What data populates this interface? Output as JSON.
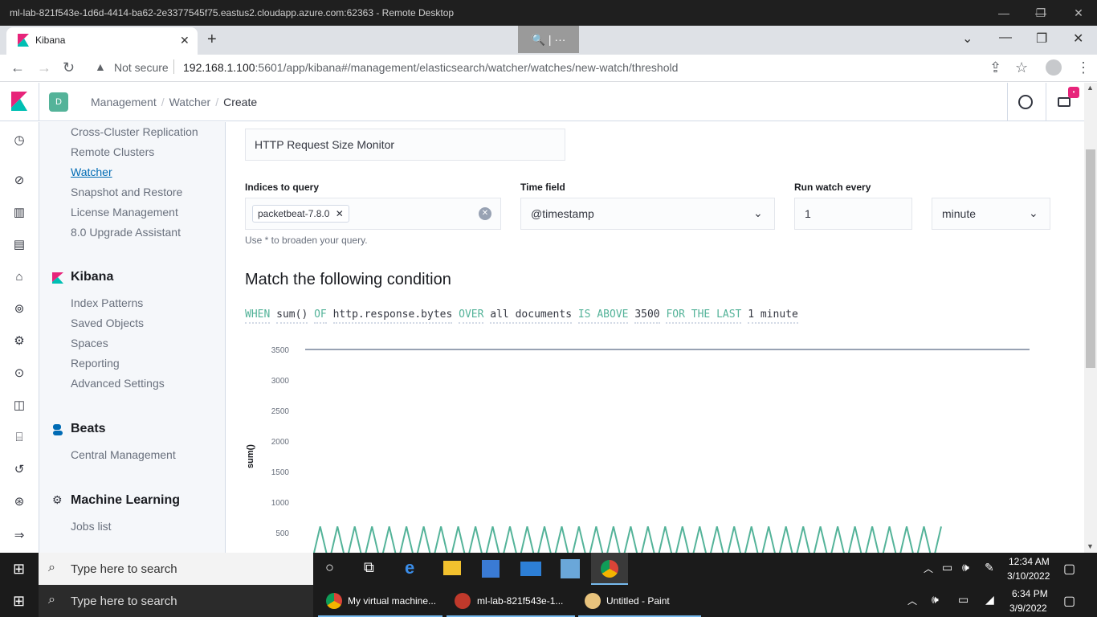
{
  "remote_desktop": {
    "title": "ml-lab-821f543e-1d6d-4414-ba62-2e3377545f75.eastus2.cloudapp.azure.com:62363 - Remote Desktop"
  },
  "browser": {
    "tab_title": "Kibana",
    "zoom_popup_label": "🔍 | ···",
    "not_secure_label": "Not secure",
    "url_host": "192.168.1.100",
    "url_rest": ":5601/app/kibana#/management/elasticsearch/watcher/watches/new-watch/threshold"
  },
  "kibana_header": {
    "space_initial": "D",
    "breadcrumbs": [
      "Management",
      "Watcher",
      "Create"
    ]
  },
  "side_nav": {
    "elasticsearch_items": [
      "Cross-Cluster Replication",
      "Remote Clusters",
      "Watcher",
      "Snapshot and Restore",
      "License Management",
      "8.0 Upgrade Assistant"
    ],
    "active_item": "Watcher",
    "kibana_heading": "Kibana",
    "kibana_items": [
      "Index Patterns",
      "Saved Objects",
      "Spaces",
      "Reporting",
      "Advanced Settings"
    ],
    "beats_heading": "Beats",
    "beats_items": [
      "Central Management"
    ],
    "ml_heading": "Machine Learning",
    "ml_items": [
      "Jobs list"
    ]
  },
  "form": {
    "name_value": "HTTP Request Size Monitor",
    "indices_label": "Indices to query",
    "indices_pill": "packetbeat-7.8.0",
    "indices_help": "Use * to broaden your query.",
    "time_field_label": "Time field",
    "time_field_value": "@timestamp",
    "run_every_label": "Run watch every",
    "run_every_value": "1",
    "run_every_unit": "minute"
  },
  "condition": {
    "title": "Match the following condition",
    "tokens": [
      {
        "text": "WHEN",
        "kw": true
      },
      {
        "text": "sum()",
        "kw": false
      },
      {
        "text": "OF",
        "kw": true
      },
      {
        "text": "http.response.bytes",
        "kw": false
      },
      {
        "text": "OVER",
        "kw": true
      },
      {
        "text": "all documents",
        "kw": false
      },
      {
        "text": "IS ABOVE",
        "kw": true
      },
      {
        "text": "3500",
        "kw": false
      },
      {
        "text": "FOR THE LAST",
        "kw": true
      },
      {
        "text": "1 minute",
        "kw": false
      }
    ]
  },
  "chart_data": {
    "type": "line",
    "ylabel": "sum()",
    "y_ticks": [
      3500,
      3000,
      2500,
      2000,
      1500,
      1000,
      500
    ],
    "ylim": [
      0,
      3500
    ],
    "threshold": 3500,
    "colors": {
      "series": "#54b399",
      "threshold": "#98a2b3"
    },
    "series": [
      {
        "values": [
          0,
          600,
          0,
          600,
          0,
          600,
          0,
          600,
          0,
          600,
          0,
          600,
          0,
          600,
          0,
          600,
          0,
          600,
          0,
          600,
          0,
          600,
          0,
          600,
          0,
          600,
          0,
          600,
          0,
          600,
          0,
          600,
          0,
          600,
          0,
          600,
          0,
          600,
          0,
          600,
          0,
          600,
          0,
          600,
          0,
          600,
          0,
          600,
          0,
          600,
          0,
          600,
          0,
          600,
          0,
          600,
          0,
          600,
          0,
          600,
          0,
          600,
          0,
          600,
          0,
          600,
          0,
          600,
          0,
          600,
          0,
          600,
          0,
          600
        ]
      }
    ]
  },
  "taskbar_remote": {
    "search_placeholder": "Type here to search",
    "time": "12:34 AM",
    "date": "3/10/2022"
  },
  "taskbar_host": {
    "search_placeholder": "Type here to search",
    "apps": [
      "My virtual machine...",
      "ml-lab-821f543e-1...",
      "Untitled - Paint"
    ],
    "time": "6:34 PM",
    "date": "3/9/2022"
  }
}
